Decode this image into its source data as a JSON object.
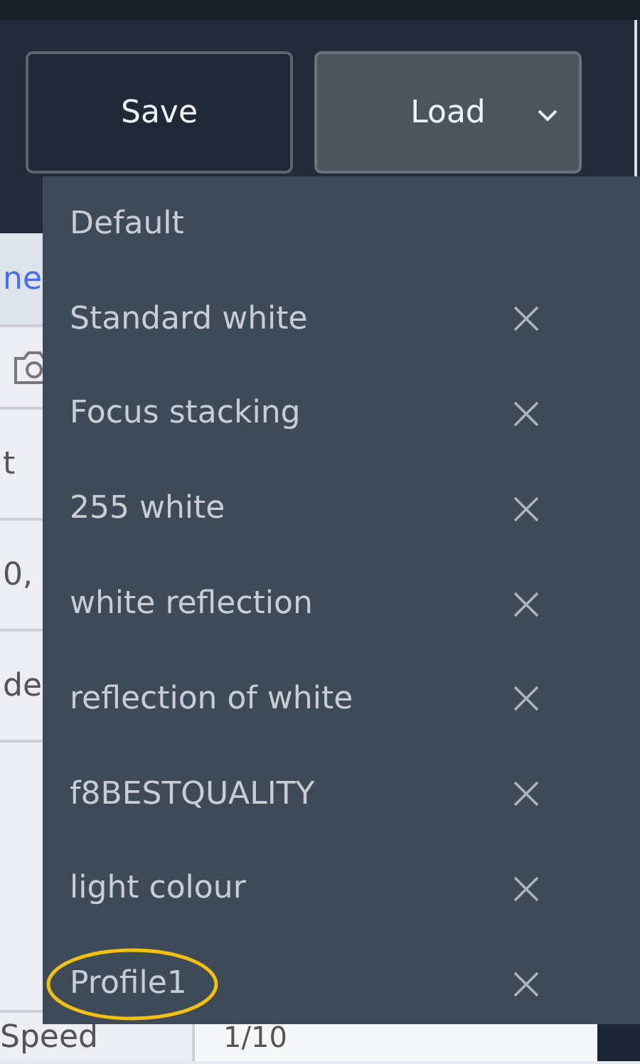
{
  "buttons": [
    {
      "label": "Save",
      "kind": "plain"
    },
    {
      "label": "Load",
      "kind": "dropdown",
      "expanded": true
    }
  ],
  "background_rows": [
    {
      "kind": "link",
      "text": "ne"
    },
    {
      "kind": "icon"
    },
    {
      "kind": "text",
      "text": "t"
    },
    {
      "kind": "text",
      "text": "0,"
    },
    {
      "kind": "text",
      "text": "de"
    },
    {
      "kind": "blank"
    }
  ],
  "speed_row": {
    "label": "Speed",
    "value": "1/10"
  },
  "menu": [
    {
      "label": "Default",
      "removable": false,
      "circled": false
    },
    {
      "label": "Standard white",
      "removable": true,
      "circled": false
    },
    {
      "label": "Focus stacking",
      "removable": true,
      "circled": false
    },
    {
      "label": "255 white",
      "removable": true,
      "circled": false
    },
    {
      "label": "white reflection",
      "removable": true,
      "circled": false
    },
    {
      "label": "reflection of white",
      "removable": true,
      "circled": false
    },
    {
      "label": "f8BESTQUALITY",
      "removable": true,
      "circled": false
    },
    {
      "label": "light colour",
      "removable": true,
      "circled": false
    },
    {
      "label": "Profile1",
      "removable": true,
      "circled": true
    }
  ]
}
